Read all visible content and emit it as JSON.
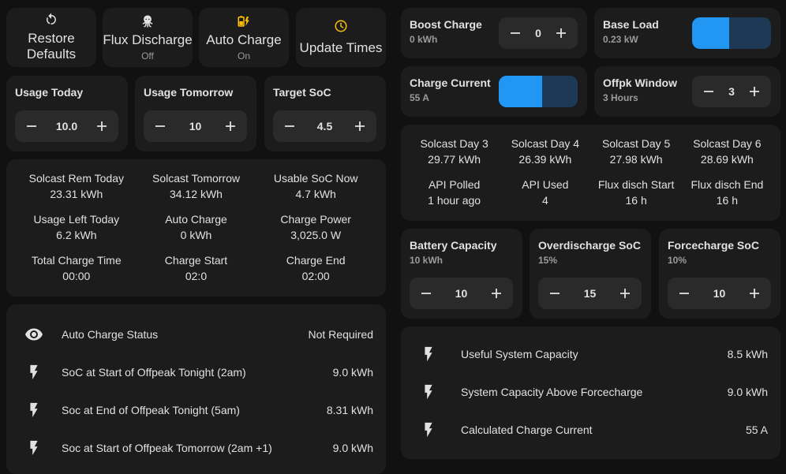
{
  "buttons": [
    {
      "name": "Restore\nDefaults",
      "state": "",
      "icon": "restore-icon"
    },
    {
      "name": "Flux Discharge",
      "state": "Off",
      "icon": "octopus-icon"
    },
    {
      "name": "Auto Charge",
      "state": "On",
      "icon": "battery-charging-icon"
    },
    {
      "name": "Update Times",
      "state": "",
      "icon": "clock-icon"
    }
  ],
  "usage_today": {
    "title": "Usage Today",
    "value": "10.0"
  },
  "usage_tomorrow": {
    "title": "Usage Tomorrow",
    "value": "10"
  },
  "target_soc": {
    "title": "Target SoC",
    "value": "4.5"
  },
  "stats_left": [
    {
      "label": "Solcast Rem Today",
      "value": "23.31 kWh"
    },
    {
      "label": "Solcast Tomorrow",
      "value": "34.12 kWh"
    },
    {
      "label": "Usable SoC Now",
      "value": "4.7 kWh"
    },
    {
      "label": "Usage Left Today",
      "value": "6.2 kWh"
    },
    {
      "label": "Auto Charge",
      "value": "0 kWh"
    },
    {
      "label": "Charge Power",
      "value": "3,025.0 W"
    },
    {
      "label": "Total Charge Time",
      "value": "00:00"
    },
    {
      "label": "Charge Start",
      "value": "02:0"
    },
    {
      "label": "Charge End",
      "value": "02:00"
    }
  ],
  "entities_left": [
    {
      "icon": "eye-icon",
      "name": "Auto Charge Status",
      "value": "Not Required"
    },
    {
      "icon": "flash-icon",
      "name": "SoC at Start of Offpeak Tonight (2am)",
      "value": "9.0 kWh"
    },
    {
      "icon": "flash-icon",
      "name": "Soc at End of Offpeak Tonight (5am)",
      "value": "8.31 kWh"
    },
    {
      "icon": "flash-icon",
      "name": "Soc at Start of Offpeak Tomorrow (2am +1)",
      "value": "9.0 kWh"
    }
  ],
  "boost_charge": {
    "title": "Boost Charge",
    "sub": "0 kWh",
    "value": "0"
  },
  "base_load": {
    "title": "Base Load",
    "sub": "0.23 kW",
    "level": 0.47
  },
  "charge_current": {
    "title": "Charge Current",
    "sub": "55 A",
    "level": 0.55
  },
  "offpk_window": {
    "title": "Offpk Window",
    "sub": "3 Hours",
    "value": "3"
  },
  "stats_right": [
    {
      "label": "Solcast Day 3",
      "value": "29.77 kWh"
    },
    {
      "label": "Solcast Day 4",
      "value": "26.39 kWh"
    },
    {
      "label": "Solcast Day 5",
      "value": "27.98 kWh"
    },
    {
      "label": "Solcast Day 6",
      "value": "28.69 kWh"
    },
    {
      "label": "API Polled",
      "value": "1 hour ago"
    },
    {
      "label": "API Used",
      "value": "4"
    },
    {
      "label": "Flux disch Start",
      "value": "16 h"
    },
    {
      "label": "Flux disch End",
      "value": "16 h"
    }
  ],
  "battery_capacity": {
    "title": "Battery Capacity",
    "sub": "10 kWh",
    "value": "10"
  },
  "overdischarge_soc": {
    "title": "Overdischarge SoC",
    "sub": "15%",
    "value": "15"
  },
  "forcecharge_soc": {
    "title": "Forcecharge SoC",
    "sub": "10%",
    "value": "10"
  },
  "entities_right": [
    {
      "icon": "flash-icon",
      "name": "Useful System Capacity",
      "value": "8.5 kWh"
    },
    {
      "icon": "flash-icon",
      "name": "System Capacity Above Forcecharge",
      "value": "9.0 kWh"
    },
    {
      "icon": "flash-icon",
      "name": "Calculated Charge Current",
      "value": "55 A"
    }
  ],
  "colors": {
    "accent": "#2196f3",
    "accent_dim": "#1e3955",
    "auto_charge_icon": "#ffc107",
    "update_icon": "#ffc107",
    "card": "#1c1c1c",
    "background": "#111111"
  }
}
